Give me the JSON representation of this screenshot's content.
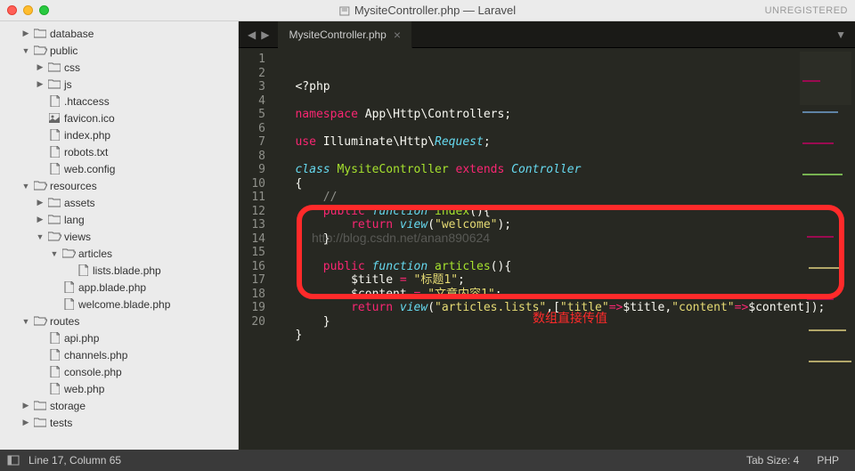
{
  "title": "MysiteController.php — Laravel",
  "unregistered": "UNREGISTERED",
  "tab": {
    "name": "MysiteController.php"
  },
  "status": {
    "pos": "Line 17, Column 65",
    "tabsize": "Tab Size: 4",
    "lang": "PHP"
  },
  "annotation": "数组直接传值",
  "watermark": "http://blog.csdn.net/anan890624",
  "tree": [
    {
      "d": 1,
      "a": "r",
      "t": "folder",
      "l": "database"
    },
    {
      "d": 1,
      "a": "d",
      "t": "folder-open",
      "l": "public"
    },
    {
      "d": 2,
      "a": "r",
      "t": "folder",
      "l": "css"
    },
    {
      "d": 2,
      "a": "r",
      "t": "folder",
      "l": "js"
    },
    {
      "d": 2,
      "a": "",
      "t": "file",
      "l": ".htaccess"
    },
    {
      "d": 2,
      "a": "",
      "t": "image",
      "l": "favicon.ico"
    },
    {
      "d": 2,
      "a": "",
      "t": "file",
      "l": "index.php"
    },
    {
      "d": 2,
      "a": "",
      "t": "file",
      "l": "robots.txt"
    },
    {
      "d": 2,
      "a": "",
      "t": "file",
      "l": "web.config"
    },
    {
      "d": 1,
      "a": "d",
      "t": "folder-open",
      "l": "resources"
    },
    {
      "d": 2,
      "a": "r",
      "t": "folder",
      "l": "assets"
    },
    {
      "d": 2,
      "a": "r",
      "t": "folder",
      "l": "lang"
    },
    {
      "d": 2,
      "a": "d",
      "t": "folder-open",
      "l": "views"
    },
    {
      "d": 3,
      "a": "d",
      "t": "folder-open",
      "l": "articles"
    },
    {
      "d": 4,
      "a": "",
      "t": "file",
      "l": "lists.blade.php"
    },
    {
      "d": 3,
      "a": "",
      "t": "file",
      "l": "app.blade.php"
    },
    {
      "d": 3,
      "a": "",
      "t": "file",
      "l": "welcome.blade.php"
    },
    {
      "d": 1,
      "a": "d",
      "t": "folder-open",
      "l": "routes"
    },
    {
      "d": 2,
      "a": "",
      "t": "file",
      "l": "api.php"
    },
    {
      "d": 2,
      "a": "",
      "t": "file",
      "l": "channels.php"
    },
    {
      "d": 2,
      "a": "",
      "t": "file",
      "l": "console.php"
    },
    {
      "d": 2,
      "a": "",
      "t": "file",
      "l": "web.php"
    },
    {
      "d": 1,
      "a": "r",
      "t": "folder",
      "l": "storage"
    },
    {
      "d": 1,
      "a": "r",
      "t": "folder",
      "l": "tests"
    }
  ],
  "lines": 20,
  "code": {
    "l1": "<?php",
    "ns": "namespace",
    "nsPath1": "App",
    "nsPath2": "Http",
    "nsPath3": "Controllers",
    "use": "use",
    "usePath1": "Illuminate",
    "usePath2": "Http",
    "useClass": "Request",
    "class": "class",
    "className": "MysiteController",
    "extends": "extends",
    "parent": "Controller",
    "public": "public",
    "function": "function",
    "fn1": "index",
    "return": "return",
    "view": "view",
    "welcome": "\"welcome\"",
    "fn2": "articles",
    "titleVar": "$title",
    "titleVal": "\"标题1\"",
    "contentVar": "$content",
    "contentVal": "\"文章内容1\"",
    "viewName": "\"articles.lists\"",
    "keyTitle": "\"title\"",
    "keyContent": "\"content\"",
    "arrow": "=>",
    "comment": "//"
  }
}
